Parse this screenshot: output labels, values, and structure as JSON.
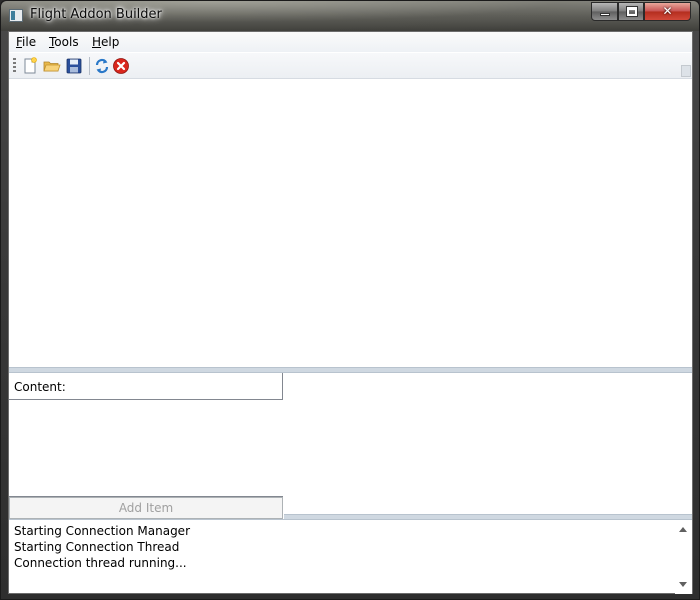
{
  "window": {
    "title": "Flight Addon Builder"
  },
  "menu": {
    "file_prefix": "F",
    "file_rest": "ile",
    "tools_prefix": "T",
    "tools_rest": "ools",
    "help_prefix": "H",
    "help_rest": "elp"
  },
  "toolbar": {
    "icons": [
      "new-document-icon",
      "open-folder-icon",
      "save-icon",
      "refresh-icon",
      "stop-icon"
    ]
  },
  "content_panel": {
    "label": "Content:",
    "add_button_label": "Add Item"
  },
  "log": {
    "lines": [
      "Starting Connection Manager",
      "Starting Connection Thread",
      "Connection thread running..."
    ]
  },
  "colors": {
    "accent": "#3f7f9c",
    "close_button": "#c75050",
    "stop_icon": "#d9261c",
    "refresh_icon": "#2a78c8"
  }
}
